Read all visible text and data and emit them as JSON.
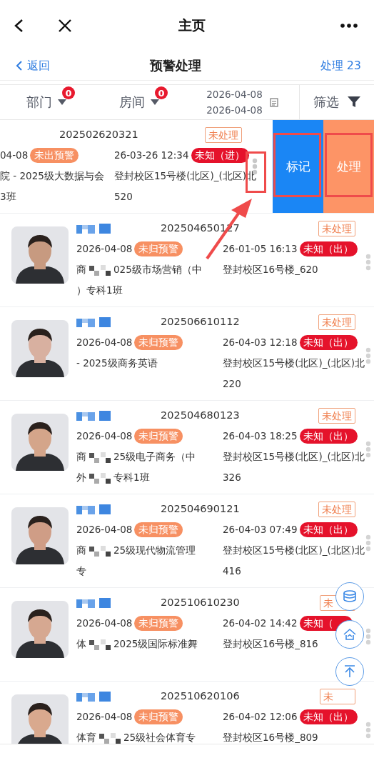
{
  "top_bar": {
    "title": "主页"
  },
  "nav": {
    "back": "返回",
    "title": "预警处理",
    "action": "处理 23"
  },
  "filters": {
    "items": [
      {
        "label": "部门",
        "count": "0"
      },
      {
        "label": "房间",
        "count": "0"
      }
    ],
    "date_from": "2026-04-08",
    "date_to": "2026-04-08",
    "filter": "筛选"
  },
  "records": [
    {
      "swiped": true,
      "id": "202502620321",
      "status": "未处理",
      "date": "04-08",
      "warning": "未出预警",
      "time": "26-03-26 12:34",
      "direction": "未知（进）",
      "dept_lines": [
        [
          "院 - 2025级大数据与会"
        ],
        [
          "3班"
        ]
      ],
      "room_lines": [
        "登封校区15号楼(北区)_(北区)北",
        "520"
      ]
    },
    {
      "swiped": false,
      "id": "202504650127",
      "status": "未处理",
      "date": "2026-04-08",
      "warning": "未归预警",
      "time": "26-01-05 16:13",
      "direction": "未知（出）",
      "dept_lines": [
        [
          "商",
          "025级市场营销（中"
        ],
        [
          "）专科1班"
        ]
      ],
      "room_lines": [
        "登封校区16号楼_620"
      ]
    },
    {
      "swiped": false,
      "id": "202506610112",
      "status": "未处理",
      "date": "2026-04-08",
      "warning": "未归预警",
      "time": "26-04-03 12:18",
      "direction": "未知（出）",
      "dept_lines": [
        [
          "- 2025级商务英语"
        ]
      ],
      "room_lines": [
        "登封校区15号楼(北区)_(北区)北",
        "220"
      ]
    },
    {
      "swiped": false,
      "id": "202504680123",
      "status": "未处理",
      "date": "2026-04-08",
      "warning": "未归预警",
      "time": "26-04-03 18:25",
      "direction": "未知（出）",
      "dept_lines": [
        [
          "商",
          "25级电子商务（中"
        ],
        [
          "外",
          "专科1班"
        ]
      ],
      "room_lines": [
        "登封校区15号楼(北区)_(北区)北",
        "326"
      ]
    },
    {
      "swiped": false,
      "id": "202504690121",
      "status": "未处理",
      "date": "2026-04-08",
      "warning": "未归预警",
      "time": "26-04-03 07:49",
      "direction": "未知（出）",
      "dept_lines": [
        [
          "商",
          "25级现代物流管理"
        ],
        [
          "专"
        ]
      ],
      "room_lines": [
        "登封校区15号楼(北区)_(北区)北",
        "416"
      ]
    },
    {
      "swiped": false,
      "id": "202510610230",
      "status": "未",
      "date": "2026-04-08",
      "warning": "未归预警",
      "time": "26-04-02 14:42",
      "direction": "未知（",
      "dept_lines": [
        [
          "体",
          "2025级国际标准舞"
        ]
      ],
      "room_lines": [
        "登封校区16号楼_816"
      ]
    },
    {
      "swiped": false,
      "id": "202510620106",
      "status": "未",
      "date": "2026-04-08",
      "warning": "未归预警",
      "time": "26-04-02 12:06",
      "direction": "未知（出）",
      "dept_lines": [
        [
          "体育",
          "25级社会体育专"
        ]
      ],
      "room_lines": [
        "登封校区16号楼_809"
      ]
    }
  ],
  "swipe_actions": [
    "标记",
    "处理"
  ]
}
